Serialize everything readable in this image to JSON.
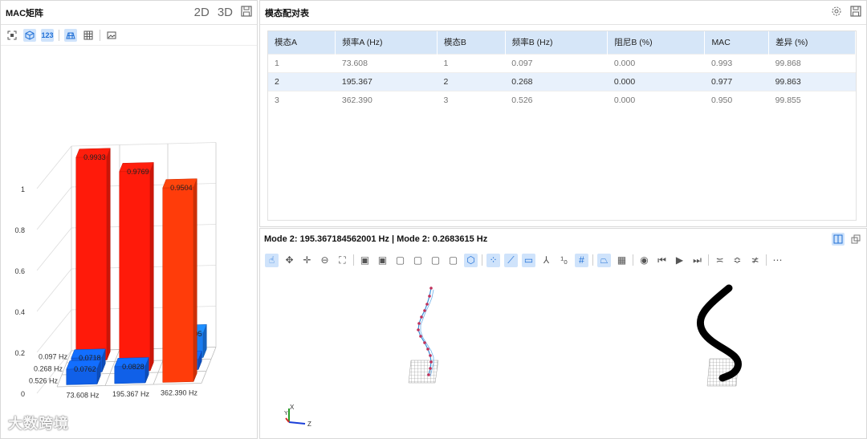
{
  "left_panel": {
    "title": "MAC矩阵",
    "btn_2d": "2D",
    "btn_3d": "3D",
    "toolbar_icons": [
      "fit-view-icon",
      "cube-icon",
      "value-label-icon",
      "surface-icon",
      "grid-icon",
      "image-icon"
    ]
  },
  "chart_data": {
    "type": "bar3d",
    "x_categories": [
      "73.608 Hz",
      "195.367 Hz",
      "362.390 Hz"
    ],
    "y_categories": [
      "0.097 Hz",
      "0.268 Hz",
      "0.526 Hz"
    ],
    "z_ticks": [
      "0",
      "0.2",
      "0.4",
      "0.6",
      "0.8",
      "1"
    ],
    "zlim": [
      0,
      1
    ],
    "bars": [
      {
        "x": 0,
        "y": 0,
        "value": 0.9933,
        "label": "0.9933",
        "color": "#ff1a0a"
      },
      {
        "x": 1,
        "y": 1,
        "value": 0.9769,
        "label": "0.9769",
        "color": "#ff1a0a"
      },
      {
        "x": 2,
        "y": 2,
        "value": 0.9504,
        "label": "0.9504",
        "color": "#ff3c0a"
      },
      {
        "x": 0,
        "y": 1,
        "value": 0.0718,
        "label": "0.0718",
        "color": "#1060e8"
      },
      {
        "x": 0,
        "y": 2,
        "value": 0.0762,
        "label": "0.0762",
        "color": "#1060e8"
      },
      {
        "x": 1,
        "y": 2,
        "value": 0.0828,
        "label": "0.0828",
        "color": "#1060e8"
      },
      {
        "x": 2,
        "y": 0,
        "value": 0.1205,
        "label": "0.1205",
        "color": "#1a7cf0"
      },
      {
        "x": 2,
        "y": 1,
        "value": 0.05,
        "label": "",
        "color": "#1060e8"
      }
    ]
  },
  "table_panel": {
    "title": "模态配对表",
    "columns": [
      "模态A",
      "频率A (Hz)",
      "模态B",
      "频率B (Hz)",
      "阻尼B (%)",
      "MAC",
      "差异 (%)"
    ],
    "rows": [
      [
        "1",
        "73.608",
        "1",
        "0.097",
        "0.000",
        "0.993",
        "99.868"
      ],
      [
        "2",
        "195.367",
        "2",
        "0.268",
        "0.000",
        "0.977",
        "99.863"
      ],
      [
        "3",
        "362.390",
        "3",
        "0.526",
        "0.000",
        "0.950",
        "99.855"
      ]
    ],
    "selected_row": 1
  },
  "mode_panel": {
    "title": "Mode 2:  195.367184562001 Hz | Mode 2:  0.2683615 Hz",
    "axis_x": "X",
    "axis_y": "Y",
    "axis_z": "Z"
  },
  "watermark": "大数跨境",
  "colors": {
    "header_blue": "#d6e6f8",
    "selected_row": "#e8f1fc",
    "accent": "#1f6fd6"
  }
}
